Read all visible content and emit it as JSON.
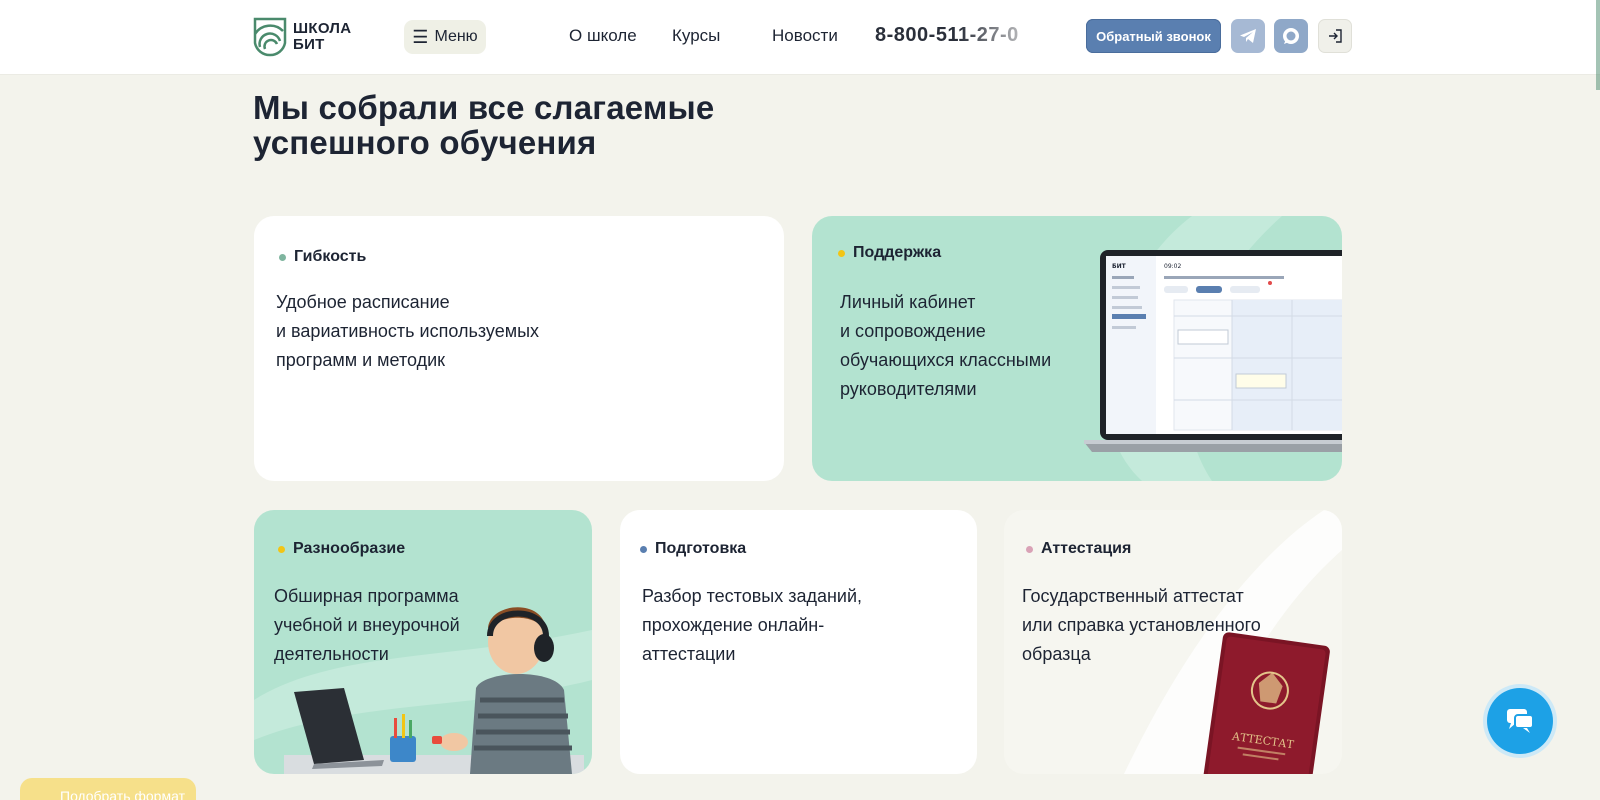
{
  "header": {
    "logo_line1": "ШКОЛА",
    "logo_line2": "БИТ",
    "menu_label": "Меню",
    "nav": [
      "О школе",
      "Курсы",
      "Новости"
    ],
    "phone": "8-800-511-27-0",
    "callback_label": "Обратный звонок"
  },
  "heading": {
    "line1": "Мы собрали все слагаемые",
    "line2": "успешного обучения"
  },
  "cards": [
    {
      "tag": "Гибкость",
      "dot_color": "#7fb59f",
      "lines": [
        "Удобное расписание",
        "и вариативность используемых",
        "программ и методик"
      ]
    },
    {
      "tag": "Поддержка",
      "dot_color": "#f2c515",
      "lines": [
        "Личный кабинет",
        "и сопровождение",
        "обучающихся классными",
        "руководителями"
      ]
    },
    {
      "tag": "Разнообразие",
      "dot_color": "#f2c515",
      "lines": [
        "Обширная программа",
        "учебной и внеурочной",
        "деятельности"
      ]
    },
    {
      "tag": "Подготовка",
      "dot_color": "#5a7fb0",
      "lines": [
        "Разбор тестовых заданий,",
        "прохождение онлайн-",
        "аттестации"
      ]
    },
    {
      "tag": "Аттестация",
      "dot_color": "#d9a2b6",
      "lines": [
        "Государственный аттестат",
        "или справка установленного",
        "образца"
      ]
    }
  ],
  "screen_mock": {
    "brand": "БИТ",
    "time": "09:02"
  },
  "passport_text": "АТТЕСТАТ",
  "pick_format_label": "Подобрать формат",
  "colors": {
    "mint": "#b3e3d0",
    "accent_blue": "#5a7fb0",
    "fab_blue": "#1da1e6"
  }
}
